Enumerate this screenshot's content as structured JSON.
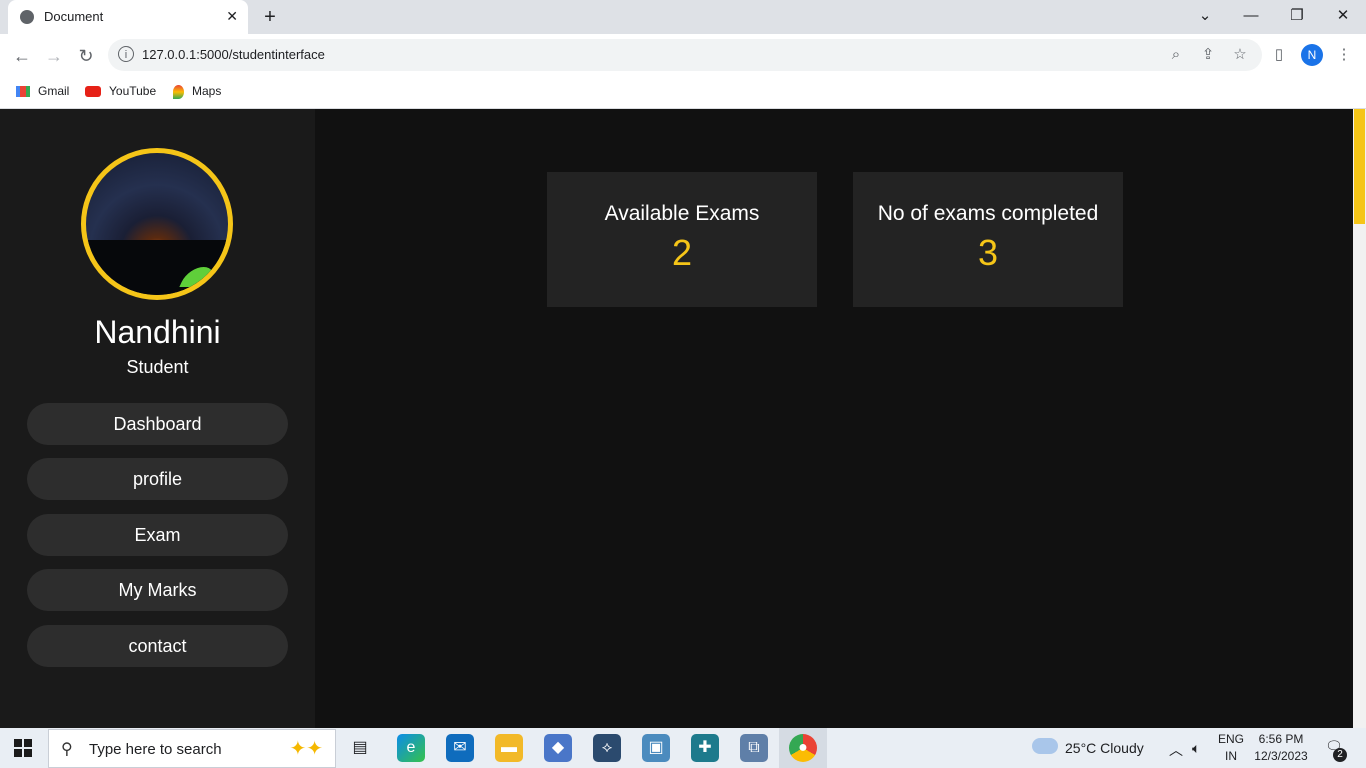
{
  "browser": {
    "tab_title": "Document",
    "url": "127.0.0.1:5000/studentinterface",
    "profile_initial": "N",
    "bookmarks": [
      {
        "label": "Gmail",
        "icon": "gmail-icon"
      },
      {
        "label": "YouTube",
        "icon": "youtube-icon"
      },
      {
        "label": "Maps",
        "icon": "maps-icon"
      }
    ]
  },
  "profile": {
    "name": "Nandhini",
    "role": "Student"
  },
  "sidebar": {
    "items": [
      {
        "label": "Dashboard"
      },
      {
        "label": "profile"
      },
      {
        "label": "Exam"
      },
      {
        "label": "My Marks"
      },
      {
        "label": "contact"
      }
    ]
  },
  "cards": [
    {
      "title": "Available Exams",
      "value": "2"
    },
    {
      "title": "No of exams completed",
      "value": "3"
    }
  ],
  "colors": {
    "accent": "#f5c518",
    "sidebar_bg": "#1a1a1a",
    "card_bg": "#232323"
  },
  "taskbar": {
    "search_placeholder": "Type here to search",
    "weather": "25°C  Cloudy",
    "lang_line1": "ENG",
    "lang_line2": "IN",
    "time": "6:56 PM",
    "date": "12/3/2023",
    "notification_count": "2"
  }
}
